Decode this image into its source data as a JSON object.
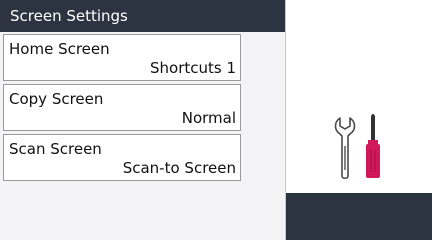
{
  "header": {
    "title": "Screen Settings"
  },
  "menu": {
    "items": [
      {
        "label": "Home Screen",
        "value": "Shortcuts 1"
      },
      {
        "label": "Copy Screen",
        "value": "Normal"
      },
      {
        "label": "Scan Screen",
        "value": "Scan-to Screen"
      }
    ]
  },
  "icons": {
    "panel_icon": "tools-icon"
  },
  "colors": {
    "title_bar": "#2c3441",
    "screwdriver_accent": "#d2185a"
  }
}
